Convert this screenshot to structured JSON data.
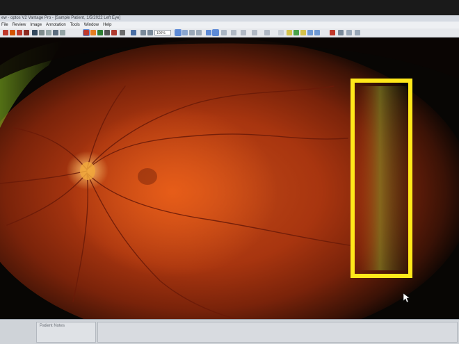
{
  "window": {
    "title": "ew - optos V2 Vantage Pro - [Sample Patient, 1/5/2022 Left Eye]"
  },
  "menu": {
    "items": [
      "File",
      "Review",
      "Image",
      "Annotation",
      "Tools",
      "Window",
      "Help"
    ]
  },
  "toolbar": {
    "zoom_value": "100%"
  },
  "viewer": {
    "image": "ultra-widefield-fundus-left-eye",
    "annotation": {
      "shape": "rectangle",
      "color": "#ffe81a"
    }
  },
  "notes": {
    "label": "Patient Notes"
  },
  "colors": {
    "annotation": "#ffe81a",
    "fundus": "#b8400f",
    "toolbar": "#e6e8ec"
  }
}
